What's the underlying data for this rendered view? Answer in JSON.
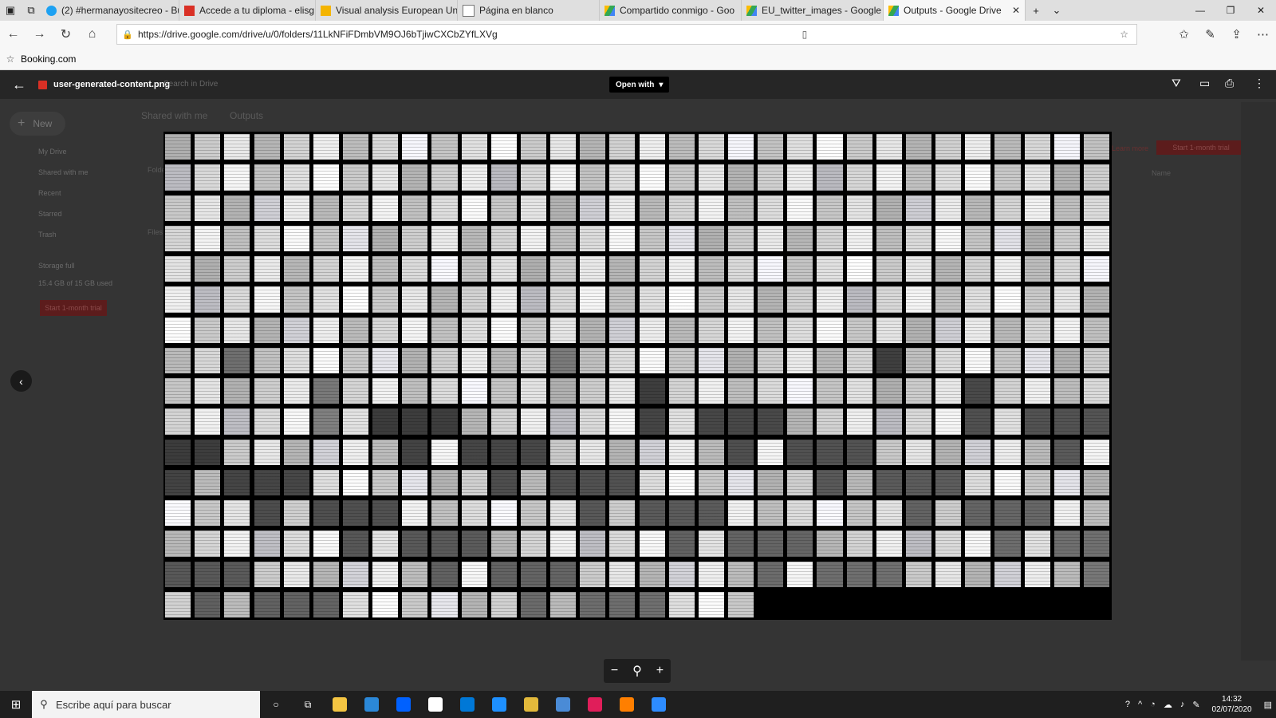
{
  "browser": {
    "tabs": [
      {
        "label": "(2) #hermanayositecreo - Bu",
        "icon": "twitter-icon",
        "color": "#1da1f2"
      },
      {
        "label": "Accede a tu diploma - elisg:",
        "icon": "gmail-icon",
        "color": "#d93025"
      },
      {
        "label": "Visual analysis European Un",
        "icon": "slides-icon",
        "color": "#f4b400"
      },
      {
        "label": "Página en blanco",
        "icon": "blank-page-icon",
        "color": "#777777"
      },
      {
        "label": "Compartido conmigo - Goo",
        "icon": "drive-icon",
        "color": "#34a853"
      },
      {
        "label": "EU_twitter_images - Google",
        "icon": "drive-icon",
        "color": "#34a853"
      },
      {
        "label": "Outputs - Google Drive",
        "icon": "drive-icon",
        "color": "#34a853",
        "active": true
      }
    ],
    "url": "https://drive.google.com/drive/u/0/folders/11LkNFiFDmbVM9OJ6bTjiwCXCbZYfLXVg",
    "bookmark": "Booking.com"
  },
  "drive_background": {
    "new_label": "New",
    "sidebar": [
      "My Drive",
      "Shared with me",
      "Recent",
      "Starred",
      "Trash"
    ],
    "storage_label": "Storage full",
    "storage_detail": "15.4 GB of 15 GB used",
    "trial_button": "Start 1-month trial",
    "breadcrumb_1": "Shared with me",
    "breadcrumb_2": "Outputs",
    "search_placeholder": "Search in Drive",
    "learn_more": "Learn more",
    "name_header": "Name",
    "folders_label": "Folders",
    "files_label": "Files"
  },
  "viewer": {
    "file_name": "user-generated-content.png",
    "open_with": "Open with",
    "mosaic": {
      "columns": 32,
      "rows": 16,
      "last_row_tiles": 20
    }
  },
  "taskbar": {
    "search_placeholder": "Escribe aquí para buscar",
    "time": "14:32",
    "date": "02/07/2020",
    "apps": [
      {
        "name": "file-explorer-icon",
        "color": "#f4c542"
      },
      {
        "name": "visual-studio-icon",
        "color": "#2b88d8"
      },
      {
        "name": "dropbox-icon",
        "color": "#0061ff"
      },
      {
        "name": "mail-icon",
        "color": "#ffffff"
      },
      {
        "name": "store-icon",
        "color": "#0078d7"
      },
      {
        "name": "edge-icon",
        "color": "#1e90ff"
      },
      {
        "name": "chrome-icon",
        "color": "#e2b93b"
      },
      {
        "name": "photos-icon",
        "color": "#4a8bd6"
      },
      {
        "name": "slack-icon",
        "color": "#e01e5a"
      },
      {
        "name": "colorful-app-icon",
        "color": "#ff7f00"
      },
      {
        "name": "zoom-icon",
        "color": "#2d8cff"
      }
    ]
  }
}
